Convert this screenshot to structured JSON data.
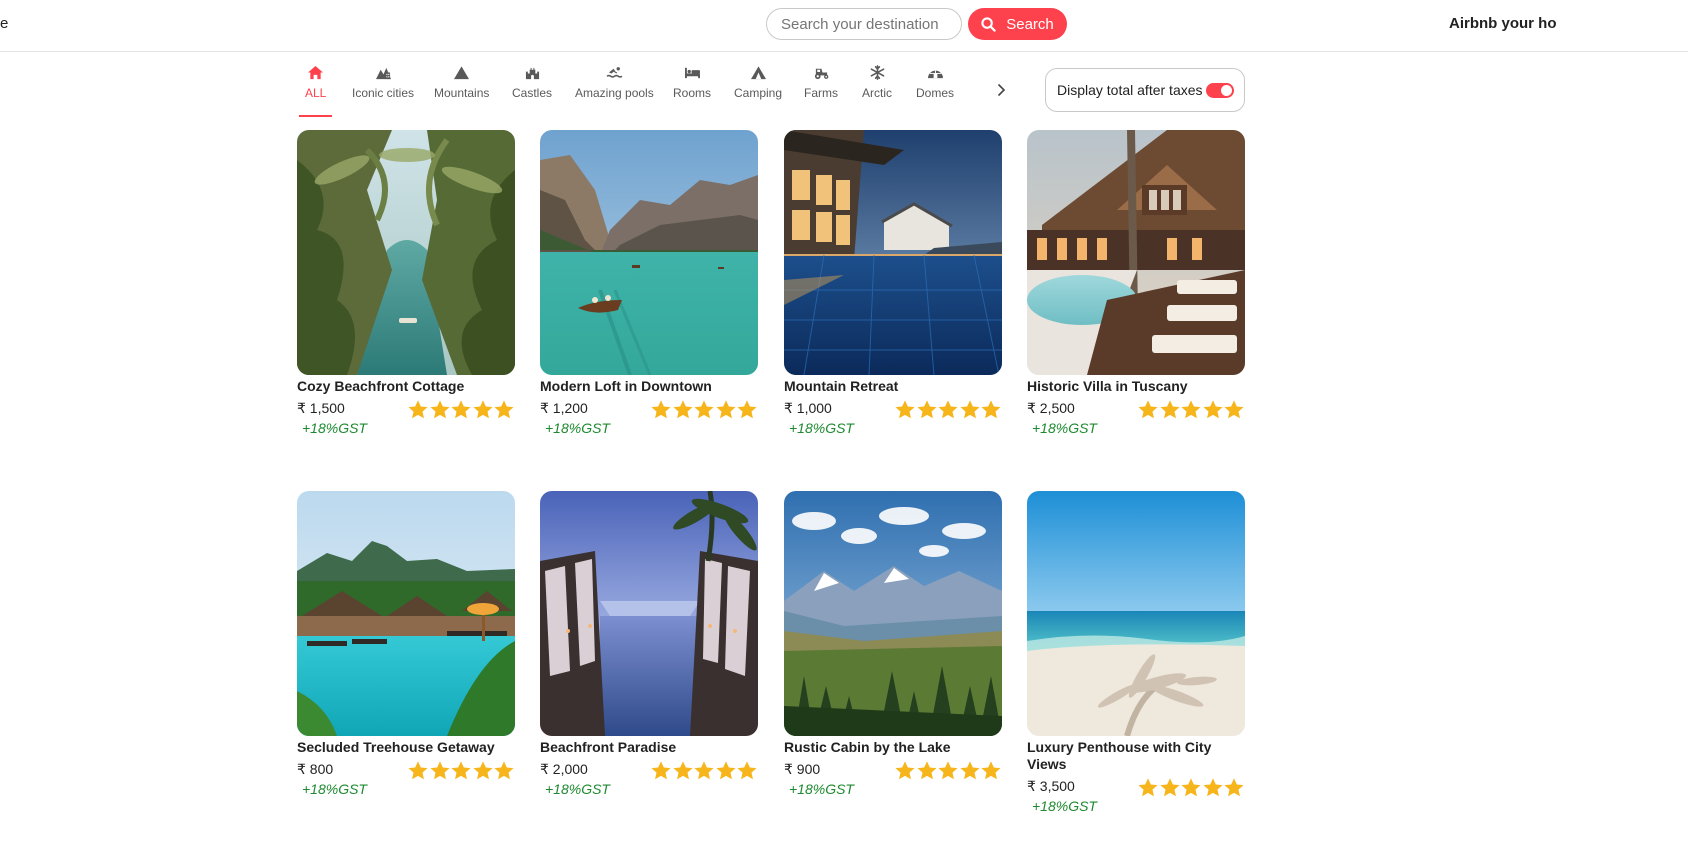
{
  "header": {
    "edge_text": "e",
    "search_placeholder": "Search your destination",
    "search_button": "Search",
    "host_link": "Airbnb your ho"
  },
  "filters": {
    "items": [
      {
        "label": "ALL",
        "icon": "home-icon",
        "active": true
      },
      {
        "label": "Iconic cities",
        "icon": "city-icon",
        "active": false
      },
      {
        "label": "Mountains",
        "icon": "mountain-icon",
        "active": false
      },
      {
        "label": "Castles",
        "icon": "castle-icon",
        "active": false
      },
      {
        "label": "Amazing pools",
        "icon": "pool-icon",
        "active": false
      },
      {
        "label": "Rooms",
        "icon": "bed-icon",
        "active": false
      },
      {
        "label": "Camping",
        "icon": "tent-icon",
        "active": false
      },
      {
        "label": "Farms",
        "icon": "tractor-icon",
        "active": false
      },
      {
        "label": "Arctic",
        "icon": "snowflake-icon",
        "active": false
      },
      {
        "label": "Domes",
        "icon": "igloo-icon",
        "active": false
      }
    ],
    "next_icon": "chevron-right-icon",
    "tax_toggle": {
      "label": "Display total after taxes",
      "on": true
    }
  },
  "colors": {
    "accent": "#fe424d",
    "star": "#f7b51c",
    "gst": "#1d8a2f"
  },
  "listings": [
    {
      "title": "Cozy Beachfront Cottage",
      "price": "₹ 1,500",
      "gst": "+18%GST",
      "rating": 5
    },
    {
      "title": "Modern Loft in Downtown",
      "price": "₹ 1,200",
      "gst": "+18%GST",
      "rating": 5
    },
    {
      "title": "Mountain Retreat",
      "price": "₹ 1,000",
      "gst": "+18%GST",
      "rating": 5
    },
    {
      "title": "Historic Villa in Tuscany",
      "price": "₹ 2,500",
      "gst": "+18%GST",
      "rating": 5
    },
    {
      "title": "Secluded Treehouse Getaway",
      "price": "₹ 800",
      "gst": "+18%GST",
      "rating": 5
    },
    {
      "title": "Beachfront Paradise",
      "price": "₹ 2,000",
      "gst": "+18%GST",
      "rating": 5
    },
    {
      "title": "Rustic Cabin by the Lake",
      "price": "₹ 900",
      "gst": "+18%GST",
      "rating": 5
    },
    {
      "title": "Luxury Penthouse with City Views",
      "price": "₹ 3,500",
      "gst": "+18%GST",
      "rating": 5
    }
  ]
}
